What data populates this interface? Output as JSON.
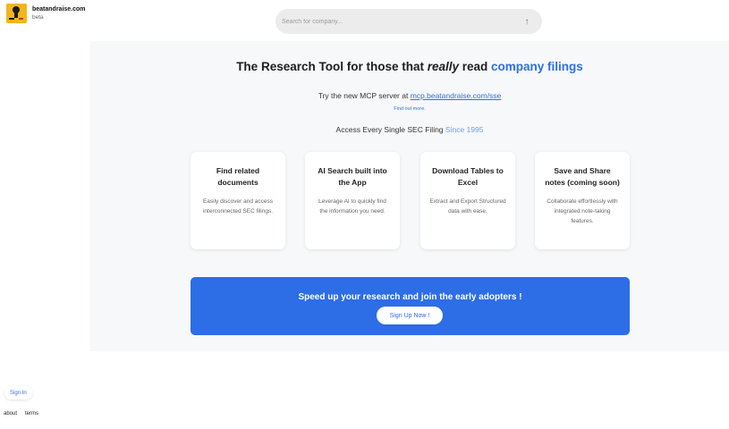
{
  "brand": {
    "name": "beatandraise.com",
    "tag": "beta",
    "logo_icon": "bear-logo-icon",
    "logo_color": "#f2b51d"
  },
  "search": {
    "placeholder": "Search for company...",
    "submit_icon": "arrow-up-icon"
  },
  "hero": {
    "headline_prefix": "The Research Tool for those that ",
    "headline_emphasis": "really",
    "headline_middle": " read ",
    "headline_accent": "company filings",
    "mcp_prefix": "Try the new MCP server at ",
    "mcp_link": "mcp.beatandraise.com/sse",
    "find_out_more": "Find out more.",
    "access_prefix": "Access Every Single SEC Filing ",
    "access_since": "Since 1995"
  },
  "features": [
    {
      "title": "Find related documents",
      "desc": "Easily discover and access interconnected SEC filings."
    },
    {
      "title": "AI Search built into the App",
      "desc": "Leverage AI to quickly find the information you need."
    },
    {
      "title": "Download Tables to Excel",
      "desc": "Extract and Export Structured data with ease."
    },
    {
      "title": "Save and Share notes (coming soon)",
      "desc": "Collaborate effortlessly with integrated note-taking features."
    }
  ],
  "cta": {
    "text": "Speed up your research and join the early adopters !",
    "button": "Sign Up Now !"
  },
  "auth": {
    "sign_in": "Sign In"
  },
  "footer": {
    "about": "about",
    "terms": "terms"
  },
  "colors": {
    "accent": "#2f6fe4",
    "cta_bg": "#2d6de6"
  }
}
